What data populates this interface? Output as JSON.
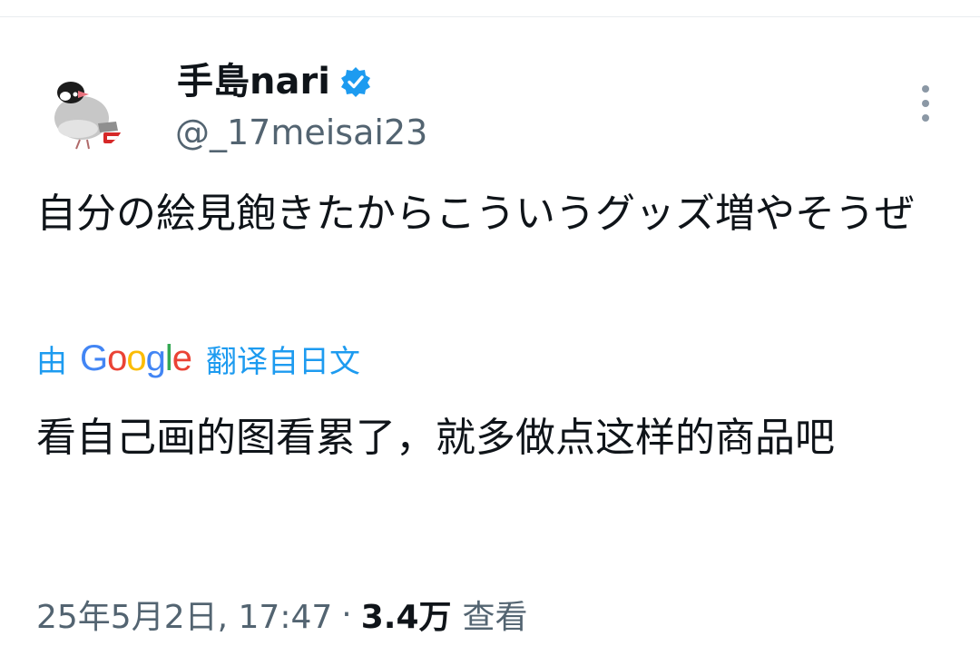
{
  "user": {
    "display_name": "手島nari",
    "handle": "@_17meisai23",
    "verified": true,
    "avatar_icon": "java-sparrow-avatar-icon"
  },
  "tweet": {
    "text": "自分の絵見飽きたからこういうグッズ増やそうぜ"
  },
  "translation": {
    "prefix": "由",
    "google": [
      "G",
      "o",
      "o",
      "g",
      "l",
      "e"
    ],
    "suffix": "翻译自日文",
    "text": "看自己画的图看累了，就多做点这样的商品吧"
  },
  "meta": {
    "timestamp": "25年5月2日, 17:47",
    "separator": "·",
    "views_count": "3.4万",
    "views_label": "查看"
  },
  "icons": {
    "verified": "verified-badge-icon",
    "more": "more-vertical-icon"
  },
  "colors": {
    "accent": "#1d9bf0",
    "text_primary": "#0f1419",
    "text_secondary": "#536471"
  }
}
